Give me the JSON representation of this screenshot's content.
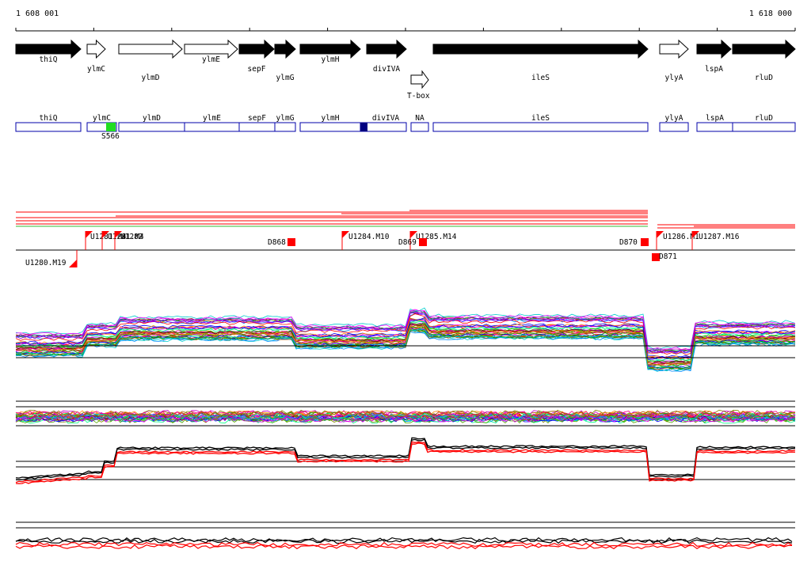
{
  "ruler": {
    "start": "1 608 001",
    "end": "1 618 000"
  },
  "genes": [
    {
      "name": "thiQ",
      "strand": "+",
      "filled": true
    },
    {
      "name": "ylmC",
      "strand": "+",
      "filled": false
    },
    {
      "name": "ylmD",
      "strand": "+",
      "filled": false
    },
    {
      "name": "ylmE",
      "strand": "+",
      "filled": false
    },
    {
      "name": "sepF",
      "strand": "+",
      "filled": true
    },
    {
      "name": "ylmG",
      "strand": "+",
      "filled": true
    },
    {
      "name": "ylmH",
      "strand": "+",
      "filled": true
    },
    {
      "name": "divIVA",
      "strand": "+",
      "filled": true
    },
    {
      "name": "ileS",
      "strand": "+",
      "filled": true
    },
    {
      "name": "ylyA",
      "strand": "+",
      "filled": false
    },
    {
      "name": "lspA",
      "strand": "+",
      "filled": true
    },
    {
      "name": "rluD",
      "strand": "+",
      "filled": true
    }
  ],
  "tbox": {
    "label": "T-box"
  },
  "regions": [
    {
      "name": "thiQ"
    },
    {
      "name": "ylmC"
    },
    {
      "name": "ylmD"
    },
    {
      "name": "ylmE"
    },
    {
      "name": "sepF"
    },
    {
      "name": "ylmG"
    },
    {
      "name": "ylmH"
    },
    {
      "name": "divIVA"
    },
    {
      "name": "NA"
    },
    {
      "name": "ileS"
    },
    {
      "name": "ylyA"
    },
    {
      "name": "lspA"
    },
    {
      "name": "rluD"
    }
  ],
  "region_markers": [
    {
      "label": "S566",
      "color": "#22dd22"
    },
    {
      "label": "",
      "color": "#000080"
    }
  ],
  "transcript_markers": {
    "upper": [
      "U1281.M4",
      "U1281.M4",
      "U1282",
      "U1284.M10",
      "U1285.M14",
      "U1286.M1",
      "U1287.M16"
    ],
    "lower": [
      "U1280.M19"
    ],
    "downshifts": [
      "D868",
      "D869",
      "D870",
      "D871"
    ]
  },
  "colors": {
    "gene_fill": "#000000",
    "region_border": "#0000aa",
    "marker_red": "#ff0000",
    "trace_black": "#000000",
    "trace_red": "#ff0000"
  }
}
